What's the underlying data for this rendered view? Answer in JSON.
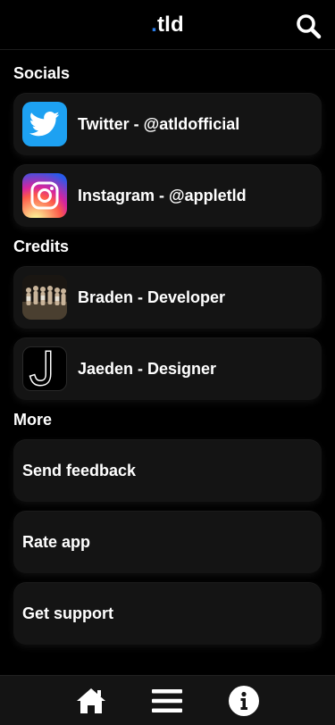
{
  "header": {
    "logo_dot": ".",
    "logo_text": "tld",
    "search_icon": "search-icon"
  },
  "sections": {
    "socials": {
      "title": "Socials",
      "items": [
        {
          "label": "Twitter - @atldofficial",
          "icon": "twitter-icon",
          "color": "#1DA1F2"
        },
        {
          "label": "Instagram - @appletld",
          "icon": "instagram-icon"
        }
      ]
    },
    "credits": {
      "title": "Credits",
      "items": [
        {
          "label": "Braden - Developer",
          "icon": "group-photo-avatar"
        },
        {
          "label": "Jaeden - Designer",
          "icon": "j-letter-avatar"
        }
      ]
    },
    "more": {
      "title": "More",
      "items": [
        {
          "label": "Send feedback"
        },
        {
          "label": "Rate app"
        },
        {
          "label": "Get support"
        }
      ]
    }
  },
  "bottom_nav": {
    "items": [
      {
        "icon": "home-icon"
      },
      {
        "icon": "menu-icon"
      },
      {
        "icon": "info-icon"
      }
    ]
  },
  "colors": {
    "background": "#000000",
    "card": "#141414",
    "accent_dot": "#2A7BE4"
  }
}
